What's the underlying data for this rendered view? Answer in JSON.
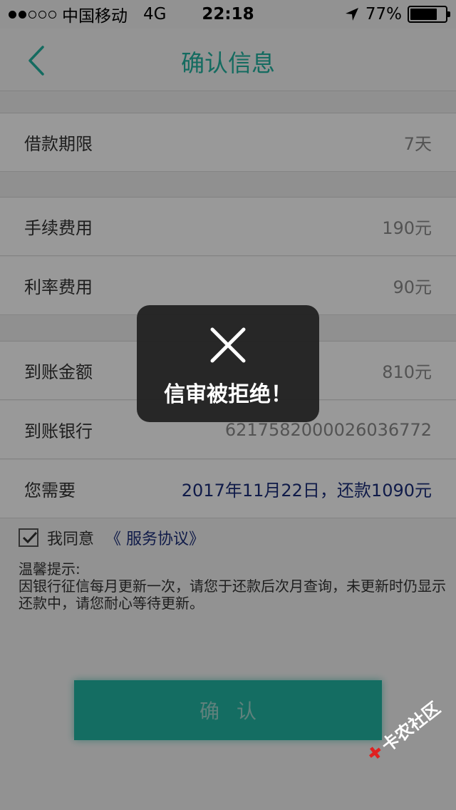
{
  "status_bar": {
    "carrier": "中国移动",
    "network": "4G",
    "time": "22:18",
    "battery": "77%",
    "battery_level": 0.77
  },
  "nav": {
    "title": "确认信息",
    "back_icon": "chevron-left-icon"
  },
  "rows": [
    {
      "label": "借款期限",
      "value": "7天"
    },
    {
      "label": "手续费用",
      "value": "190元"
    },
    {
      "label": "利率费用",
      "value": "90元"
    },
    {
      "label": "到账金额",
      "value": "810元"
    },
    {
      "label": "到账银行",
      "value": "6217582000026036772"
    },
    {
      "label": "您需要",
      "value": "2017年11月22日，还款1090元"
    }
  ],
  "agreement": {
    "checked": true,
    "text": "我同意",
    "link": "《 服务协议》"
  },
  "tips": {
    "title": "温馨提示:",
    "body": "因银行征信每月更新一次，请您于还款后次月查询，未更新时仍显示还款中，请您耐心等待更新。"
  },
  "confirm_button": {
    "label": "确认"
  },
  "toast": {
    "icon": "close-icon",
    "message": "信审被拒绝！"
  },
  "watermark": {
    "text": "卡农社区"
  },
  "colors": {
    "accent": "#22b3a0",
    "link": "#1c2e7a"
  }
}
